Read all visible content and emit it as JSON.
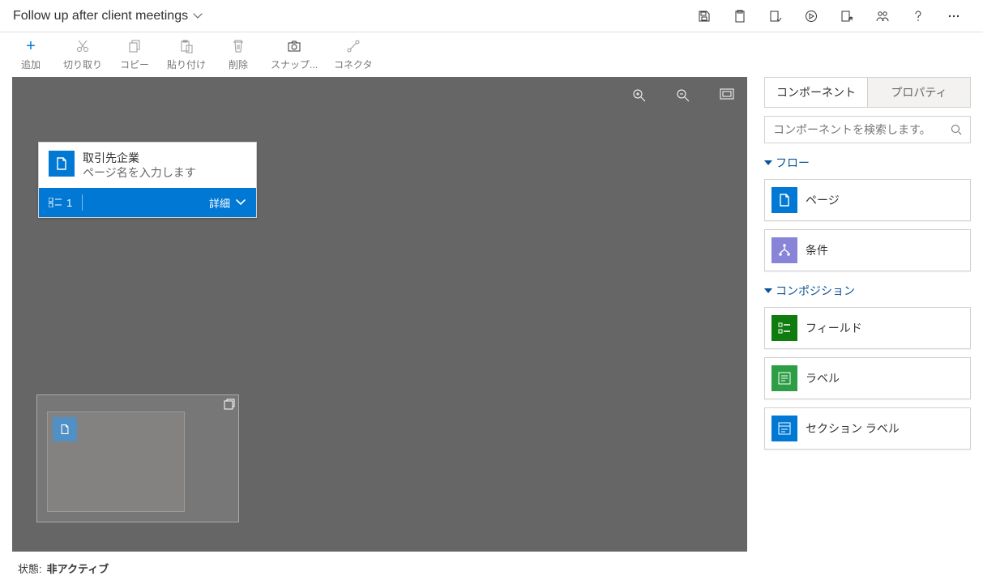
{
  "header": {
    "title": "Follow up after client meetings"
  },
  "toolbar": {
    "add": "追加",
    "cut": "切り取り",
    "copy": "コピー",
    "paste": "貼り付け",
    "delete": "削除",
    "snap": "スナップ...",
    "connector": "コネクタ"
  },
  "canvasNode": {
    "entity": "取引先企業",
    "placeholder": "ページ名を入力します",
    "count": "1",
    "details": "詳細"
  },
  "sidePanel": {
    "tabs": {
      "components": "コンポーネント",
      "properties": "プロパティ"
    },
    "searchPlaceholder": "コンポーネントを検索します。",
    "sections": {
      "flow": {
        "label": "フロー",
        "items": {
          "page": "ページ",
          "condition": "条件"
        }
      },
      "composition": {
        "label": "コンポジション",
        "items": {
          "field": "フィールド",
          "label": "ラベル",
          "sectionLabel": "セクション ラベル"
        }
      }
    }
  },
  "status": {
    "label": "状態:",
    "value": "非アクティブ"
  }
}
